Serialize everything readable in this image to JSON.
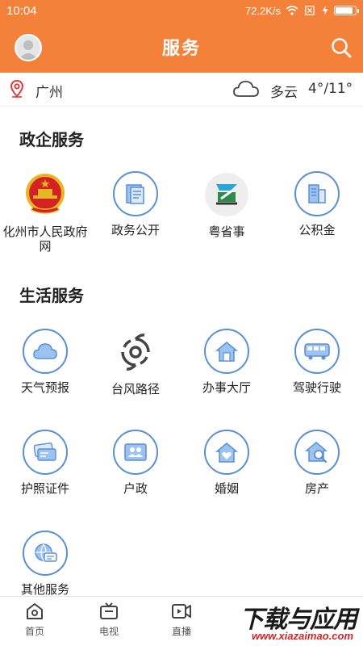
{
  "status_bar": {
    "time": "10:04",
    "network_speed": "72.2K/s",
    "battery_level": 0.8
  },
  "header": {
    "title": "服务",
    "avatar_icon": "user-avatar-icon",
    "search_icon": "search-icon"
  },
  "location": {
    "city": "广州",
    "weather": "多云",
    "temperature": "4°/11°",
    "pin_icon": "location-pin-icon",
    "weather_icon": "cloud-icon"
  },
  "gov_section": {
    "title": "政企服务",
    "items": [
      {
        "label": "化州市人民政府网",
        "icon": "national-emblem-icon"
      },
      {
        "label": "政务公开",
        "icon": "document-icon"
      },
      {
        "label": "粤省事",
        "icon": "yueshengshi-icon"
      },
      {
        "label": "公积金",
        "icon": "building-icon"
      }
    ]
  },
  "life_section": {
    "title": "生活服务",
    "items": [
      {
        "label": "天气预报",
        "icon": "cloud-icon"
      },
      {
        "label": "台风路径",
        "icon": "typhoon-icon"
      },
      {
        "label": "办事大厅",
        "icon": "house-icon"
      },
      {
        "label": "驾驶行驶",
        "icon": "bus-icon"
      },
      {
        "label": "护照证件",
        "icon": "card-icon"
      },
      {
        "label": "户政",
        "icon": "household-icon"
      },
      {
        "label": "婚姻",
        "icon": "heart-house-icon"
      },
      {
        "label": "房产",
        "icon": "house-search-icon"
      },
      {
        "label": "其他服务",
        "icon": "globe-chat-icon"
      }
    ]
  },
  "bottom_nav": [
    {
      "label": "首页",
      "icon": "home-icon"
    },
    {
      "label": "电视",
      "icon": "tv-icon"
    },
    {
      "label": "直播",
      "icon": "live-video-icon"
    }
  ],
  "watermark": {
    "main": "下载与应用",
    "sub": "www.xiazaimao.com"
  },
  "colors": {
    "brand_orange": "#f4813a",
    "icon_blue": "#5a8fd6",
    "icon_fill_blue": "#9cc3f0"
  }
}
